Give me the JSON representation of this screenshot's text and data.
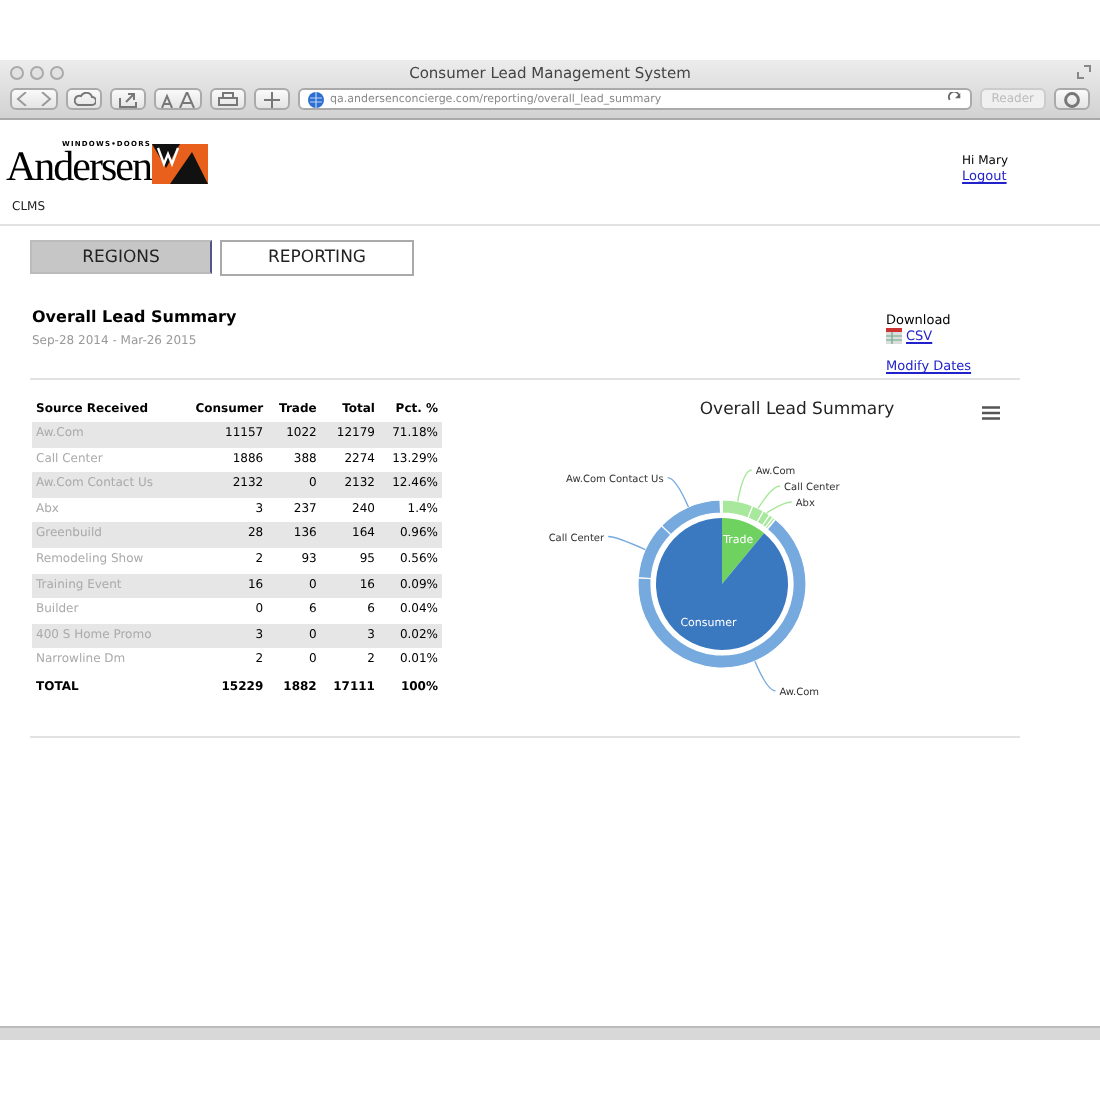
{
  "window": {
    "title": "Consumer Lead Management System",
    "url": "qa.andersenconcierge.com/reporting/overall_lead_summary",
    "reader": "Reader"
  },
  "header": {
    "brand": "Andersen",
    "brand_tagline": "WINDOWS•DOORS",
    "app_name": "CLMS",
    "greeting": "Hi Mary",
    "logout": "Logout"
  },
  "tabs": [
    {
      "label": "REGIONS",
      "selected": false
    },
    {
      "label": "REPORTING",
      "selected": true
    }
  ],
  "summary": {
    "title": "Overall Lead Summary",
    "date_range": "Sep-28 2014 - Mar-26 2015",
    "download_label": "Download",
    "csv_link": "CSV",
    "modify_dates": "Modify Dates"
  },
  "table": {
    "columns": [
      "Source Received",
      "Consumer",
      "Trade",
      "Total",
      "Pct. %"
    ],
    "rows": [
      {
        "source": "Aw.Com",
        "consumer": "11157",
        "trade": "1022",
        "total": "12179",
        "pct": "71.18%"
      },
      {
        "source": "Call Center",
        "consumer": "1886",
        "trade": "388",
        "total": "2274",
        "pct": "13.29%"
      },
      {
        "source": "Aw.Com Contact Us",
        "consumer": "2132",
        "trade": "0",
        "total": "2132",
        "pct": "12.46%"
      },
      {
        "source": "Abx",
        "consumer": "3",
        "trade": "237",
        "total": "240",
        "pct": "1.4%"
      },
      {
        "source": "Greenbuild",
        "consumer": "28",
        "trade": "136",
        "total": "164",
        "pct": "0.96%"
      },
      {
        "source": "Remodeling Show",
        "consumer": "2",
        "trade": "93",
        "total": "95",
        "pct": "0.56%"
      },
      {
        "source": "Training Event",
        "consumer": "16",
        "trade": "0",
        "total": "16",
        "pct": "0.09%"
      },
      {
        "source": "Builder",
        "consumer": "0",
        "trade": "6",
        "total": "6",
        "pct": "0.04%"
      },
      {
        "source": "400 S Home Promo",
        "consumer": "3",
        "trade": "0",
        "total": "3",
        "pct": "0.02%"
      },
      {
        "source": "Narrowline Dm",
        "consumer": "2",
        "trade": "0",
        "total": "2",
        "pct": "0.01%"
      }
    ],
    "total": {
      "source": "TOTAL",
      "consumer": "15229",
      "trade": "1882",
      "total": "17111",
      "pct": "100%"
    }
  },
  "chart": {
    "title": "Overall Lead Summary",
    "inner_labels": [
      {
        "text": "Trade",
        "kind": "trade"
      },
      {
        "text": "Consumer",
        "kind": "consumer"
      }
    ],
    "outer_labels": [
      {
        "text": "Aw.Com",
        "kind": "trade"
      },
      {
        "text": "Call Center",
        "kind": "trade"
      },
      {
        "text": "Abx",
        "kind": "trade"
      },
      {
        "text": "Aw.Com",
        "kind": "consumer"
      },
      {
        "text": "Call Center",
        "kind": "consumer"
      },
      {
        "text": "Aw.Com Contact Us",
        "kind": "consumer"
      }
    ]
  }
}
